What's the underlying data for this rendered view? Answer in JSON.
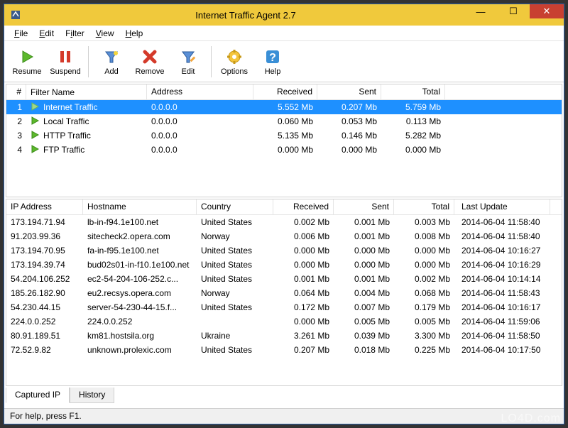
{
  "window": {
    "title": "Internet Traffic Agent 2.7"
  },
  "menus": {
    "file": "File",
    "edit": "Edit",
    "filter": "Filter",
    "view": "View",
    "help": "Help"
  },
  "toolbar": {
    "resume": "Resume",
    "suspend": "Suspend",
    "add": "Add",
    "remove": "Remove",
    "edit": "Edit",
    "options": "Options",
    "help": "Help"
  },
  "filter_columns": {
    "num": "#",
    "name": "Filter Name",
    "address": "Address",
    "received": "Received",
    "sent": "Sent",
    "total": "Total"
  },
  "filters": [
    {
      "num": "1",
      "name": "Internet Traffic",
      "address": "0.0.0.0",
      "received": "5.552 Mb",
      "sent": "0.207 Mb",
      "total": "5.759 Mb",
      "selected": true
    },
    {
      "num": "2",
      "name": "Local Traffic",
      "address": "0.0.0.0",
      "received": "0.060 Mb",
      "sent": "0.053 Mb",
      "total": "0.113 Mb",
      "selected": false
    },
    {
      "num": "3",
      "name": "HTTP Traffic",
      "address": "0.0.0.0",
      "received": "5.135 Mb",
      "sent": "0.146 Mb",
      "total": "5.282 Mb",
      "selected": false
    },
    {
      "num": "4",
      "name": "FTP Traffic",
      "address": "0.0.0.0",
      "received": "0.000 Mb",
      "sent": "0.000 Mb",
      "total": "0.000 Mb",
      "selected": false
    }
  ],
  "ip_columns": {
    "ip": "IP Address",
    "host": "Hostname",
    "country": "Country",
    "received": "Received",
    "sent": "Sent",
    "total": "Total",
    "last": "Last Update"
  },
  "ips": [
    {
      "ip": "173.194.71.94",
      "host": "lb-in-f94.1e100.net",
      "country": "United States",
      "received": "0.002 Mb",
      "sent": "0.001 Mb",
      "total": "0.003 Mb",
      "last": "2014-06-04  11:58:40"
    },
    {
      "ip": "91.203.99.36",
      "host": "sitecheck2.opera.com",
      "country": "Norway",
      "received": "0.006 Mb",
      "sent": "0.001 Mb",
      "total": "0.008 Mb",
      "last": "2014-06-04  11:58:40"
    },
    {
      "ip": "173.194.70.95",
      "host": "fa-in-f95.1e100.net",
      "country": "United States",
      "received": "0.000 Mb",
      "sent": "0.000 Mb",
      "total": "0.000 Mb",
      "last": "2014-06-04  10:16:27"
    },
    {
      "ip": "173.194.39.74",
      "host": "bud02s01-in-f10.1e100.net",
      "country": "United States",
      "received": "0.000 Mb",
      "sent": "0.000 Mb",
      "total": "0.000 Mb",
      "last": "2014-06-04  10:16:29"
    },
    {
      "ip": "54.204.106.252",
      "host": "ec2-54-204-106-252.c...",
      "country": "United States",
      "received": "0.001 Mb",
      "sent": "0.001 Mb",
      "total": "0.002 Mb",
      "last": "2014-06-04  10:14:14"
    },
    {
      "ip": "185.26.182.90",
      "host": "eu2.recsys.opera.com",
      "country": "Norway",
      "received": "0.064 Mb",
      "sent": "0.004 Mb",
      "total": "0.068 Mb",
      "last": "2014-06-04  11:58:43"
    },
    {
      "ip": "54.230.44.15",
      "host": "server-54-230-44-15.f...",
      "country": "United States",
      "received": "0.172 Mb",
      "sent": "0.007 Mb",
      "total": "0.179 Mb",
      "last": "2014-06-04  10:16:17"
    },
    {
      "ip": "224.0.0.252",
      "host": "224.0.0.252",
      "country": "",
      "received": "0.000 Mb",
      "sent": "0.005 Mb",
      "total": "0.005 Mb",
      "last": "2014-06-04  11:59:06"
    },
    {
      "ip": "80.91.189.51",
      "host": "km81.hostsila.org",
      "country": "Ukraine",
      "received": "3.261 Mb",
      "sent": "0.039 Mb",
      "total": "3.300 Mb",
      "last": "2014-06-04  11:58:50"
    },
    {
      "ip": "72.52.9.82",
      "host": "unknown.prolexic.com",
      "country": "United States",
      "received": "0.207 Mb",
      "sent": "0.018 Mb",
      "total": "0.225 Mb",
      "last": "2014-06-04  10:17:50"
    },
    {
      "ip": "",
      "host": "",
      "country": "",
      "received": "",
      "sent": "",
      "total": "",
      "last": ""
    }
  ],
  "tabs": {
    "captured": "Captured IP",
    "history": "History"
  },
  "status": "For help, press F1.",
  "watermark": "LO4D.com"
}
